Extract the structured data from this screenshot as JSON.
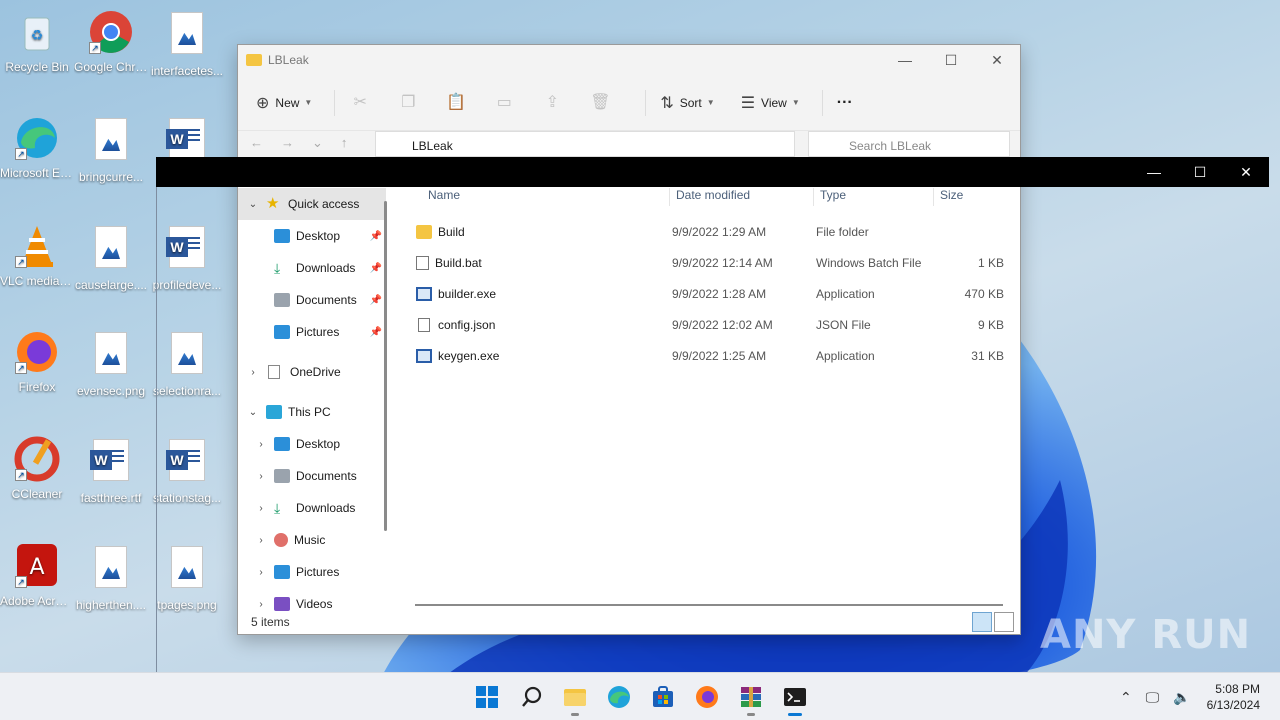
{
  "desktop": {
    "icons": [
      {
        "label": "Recycle Bin"
      },
      {
        "label": "Google Chrome"
      },
      {
        "label": "interfacetes..."
      },
      {
        "label": "Microsoft Edge"
      },
      {
        "label": "bringcurre..."
      },
      {
        "label": "VLC media player"
      },
      {
        "label": "causelarge...."
      },
      {
        "label": "profiledeve..."
      },
      {
        "label": "Firefox"
      },
      {
        "label": "evensec.png"
      },
      {
        "label": "selectionra..."
      },
      {
        "label": "CCleaner"
      },
      {
        "label": "fastthree.rtf"
      },
      {
        "label": "stationstag..."
      },
      {
        "label": "Adobe Acrobat"
      },
      {
        "label": "higherthen...."
      },
      {
        "label": "tpages.png"
      }
    ]
  },
  "explorer": {
    "title": "LBLeak",
    "toolbar": {
      "new": "New",
      "sort": "Sort",
      "view": "View",
      "more": "···"
    },
    "address": "LBLeak",
    "search_placeholder": "Search LBLeak",
    "nav": [
      {
        "label": "Quick access"
      },
      {
        "label": "Desktop"
      },
      {
        "label": "Downloads"
      },
      {
        "label": "Documents"
      },
      {
        "label": "Pictures"
      },
      {
        "label": "OneDrive"
      },
      {
        "label": "This PC"
      },
      {
        "label": "Desktop"
      },
      {
        "label": "Documents"
      },
      {
        "label": "Downloads"
      },
      {
        "label": "Music"
      },
      {
        "label": "Pictures"
      },
      {
        "label": "Videos"
      }
    ],
    "columns": {
      "name": "Name",
      "date": "Date modified",
      "type": "Type",
      "size": "Size"
    },
    "files": [
      {
        "name": "Build",
        "date": "9/9/2022 1:29 AM",
        "type": "File folder",
        "size": ""
      },
      {
        "name": "Build.bat",
        "date": "9/9/2022 12:14 AM",
        "type": "Windows Batch File",
        "size": "1 KB"
      },
      {
        "name": "builder.exe",
        "date": "9/9/2022 1:28 AM",
        "type": "Application",
        "size": "470 KB"
      },
      {
        "name": "config.json",
        "date": "9/9/2022 12:02 AM",
        "type": "JSON File",
        "size": "9 KB"
      },
      {
        "name": "keygen.exe",
        "date": "9/9/2022 1:25 AM",
        "type": "Application",
        "size": "31 KB"
      }
    ],
    "status": "5 items"
  },
  "taskbar": {
    "time": "5:08 PM",
    "date": "6/13/2024"
  },
  "watermark": "ANY RUN",
  "colors": {
    "folder": "#f4c542",
    "accent": "#0067c0",
    "taskbar": "#eef0f4"
  }
}
